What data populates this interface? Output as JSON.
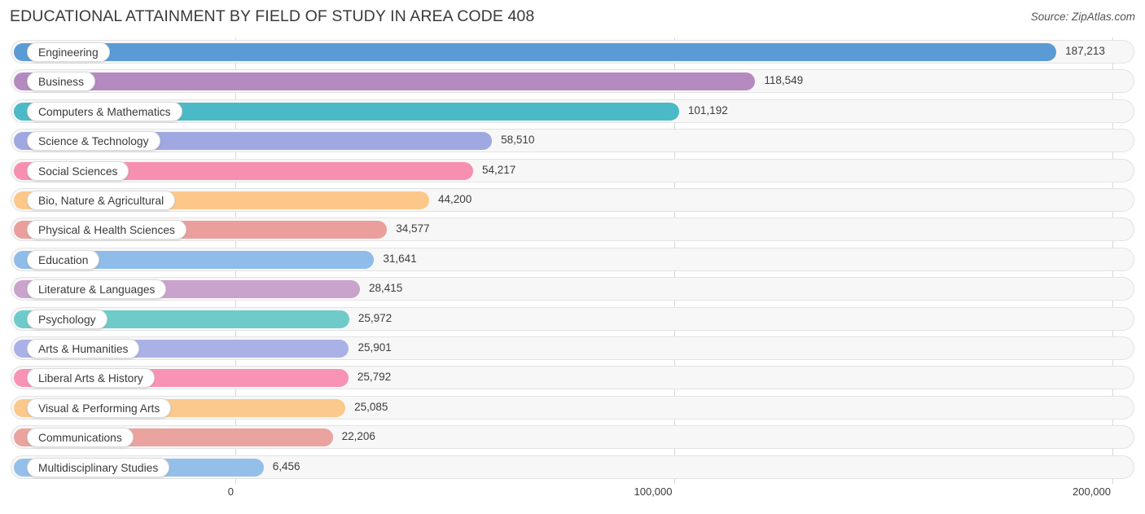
{
  "header": {
    "title": "EDUCATIONAL ATTAINMENT BY FIELD OF STUDY IN AREA CODE 408",
    "source": "Source: ZipAtlas.com"
  },
  "chart_data": {
    "type": "bar",
    "orientation": "horizontal",
    "title": "EDUCATIONAL ATTAINMENT BY FIELD OF STUDY IN AREA CODE 408",
    "xlabel": "",
    "ylabel": "",
    "xlim": [
      0,
      200000
    ],
    "grid": true,
    "legend": "none",
    "xticks": [
      0,
      100000,
      200000
    ],
    "xtick_labels": [
      "0",
      "100,000",
      "200,000"
    ],
    "categories": [
      "Engineering",
      "Business",
      "Computers & Mathematics",
      "Science & Technology",
      "Social Sciences",
      "Bio, Nature & Agricultural",
      "Physical & Health Sciences",
      "Education",
      "Literature & Languages",
      "Psychology",
      "Arts & Humanities",
      "Liberal Arts & History",
      "Visual & Performing Arts",
      "Communications",
      "Multidisciplinary Studies"
    ],
    "values": [
      187213,
      118549,
      101192,
      58510,
      54217,
      44200,
      34577,
      31641,
      28415,
      25972,
      25901,
      25792,
      25085,
      22206,
      6456
    ],
    "value_labels": [
      "187,213",
      "118,549",
      "101,192",
      "58,510",
      "54,217",
      "44,200",
      "34,577",
      "31,641",
      "28,415",
      "25,972",
      "25,901",
      "25,792",
      "25,085",
      "22,206",
      "6,456"
    ],
    "colors": [
      "#5b9bd5",
      "#b48ac0",
      "#4cbac6",
      "#9fa8e0",
      "#f790b0",
      "#fcc88a",
      "#eb9f9c",
      "#8fbce8",
      "#c9a3cc",
      "#6ecbc9",
      "#aab1e6",
      "#f893b5",
      "#fbc88d",
      "#eba39f",
      "#94bfe8"
    ]
  },
  "rows": [
    {
      "label": "Engineering",
      "value_label": "187,213",
      "value": 187213,
      "color": "#5b9bd5"
    },
    {
      "label": "Business",
      "value_label": "118,549",
      "value": 118549,
      "color": "#b48ac0"
    },
    {
      "label": "Computers & Mathematics",
      "value_label": "101,192",
      "value": 101192,
      "color": "#4cbac6"
    },
    {
      "label": "Science & Technology",
      "value_label": "58,510",
      "value": 58510,
      "color": "#9fa8e0"
    },
    {
      "label": "Social Sciences",
      "value_label": "54,217",
      "value": 54217,
      "color": "#f790b0"
    },
    {
      "label": "Bio, Nature & Agricultural",
      "value_label": "44,200",
      "value": 44200,
      "color": "#fcc88a"
    },
    {
      "label": "Physical & Health Sciences",
      "value_label": "34,577",
      "value": 34577,
      "color": "#eb9f9c"
    },
    {
      "label": "Education",
      "value_label": "31,641",
      "value": 31641,
      "color": "#8fbce8"
    },
    {
      "label": "Literature & Languages",
      "value_label": "28,415",
      "value": 28415,
      "color": "#c9a3cc"
    },
    {
      "label": "Psychology",
      "value_label": "25,972",
      "value": 25972,
      "color": "#6ecbc9"
    },
    {
      "label": "Arts & Humanities",
      "value_label": "25,901",
      "value": 25901,
      "color": "#aab1e6"
    },
    {
      "label": "Liberal Arts & History",
      "value_label": "25,792",
      "value": 25792,
      "color": "#f893b5"
    },
    {
      "label": "Visual & Performing Arts",
      "value_label": "25,085",
      "value": 25085,
      "color": "#fbc88d"
    },
    {
      "label": "Communications",
      "value_label": "22,206",
      "value": 22206,
      "color": "#eba39f"
    },
    {
      "label": "Multidisciplinary Studies",
      "value_label": "6,456",
      "value": 6456,
      "color": "#94bfe8"
    }
  ],
  "axis": {
    "ticks": [
      "0",
      "100,000",
      "200,000"
    ]
  }
}
